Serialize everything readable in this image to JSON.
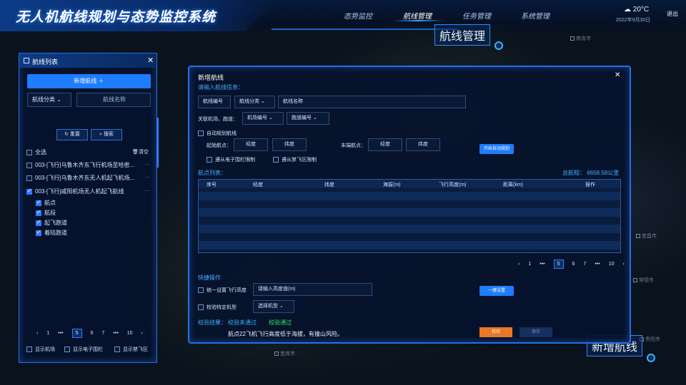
{
  "header": {
    "title": "无人机航线规划与态势监控系统",
    "nav": [
      "态势监控",
      "航线管理",
      "任务管理",
      "系统管理"
    ],
    "active_nav": "航线管理",
    "temperature": "20°C",
    "date": "2022年9月30日",
    "logout": "退出"
  },
  "map": {
    "cities": [
      "商洛市",
      "宜昌市",
      "常德市",
      "贵阳市",
      "宜宾市"
    ]
  },
  "float_labels": {
    "top": "航线管理",
    "bottom": "新增航线"
  },
  "sidebar": {
    "title": "航线列表",
    "add_button": "新增航线 ＋",
    "filter_category": "航线分类",
    "filter_name_placeholder": "航线名称",
    "reset_button": "重置",
    "search_button": "搜索",
    "select_all": "全选",
    "clear": "清空",
    "routes": [
      {
        "label": "003-[飞行]乌鲁木齐东飞行机场至哈密...",
        "checked": false
      },
      {
        "label": "003-[飞行]乌鲁木齐东无人机起飞机场...",
        "checked": false
      },
      {
        "label": "003-[飞行]咸阳机场无人机起飞航线",
        "checked": true
      }
    ],
    "sub_items": [
      "航点",
      "航段",
      "起飞跑道",
      "着陆跑道"
    ],
    "pagination": [
      "1",
      "•••",
      "5",
      "6",
      "7",
      "•••",
      "10"
    ],
    "show_airport": "显示机场",
    "show_fence": "显示电子围栏",
    "show_nofly": "显示禁飞区"
  },
  "dialog": {
    "title": "新增航线",
    "section_info": "请输入航线信息：",
    "route_no_placeholder": "航线编号",
    "route_category": "航线分类",
    "route_name_placeholder": "航线名称",
    "link_label": "关联机场、跑道：",
    "airport_select": "机场编号",
    "runway_select": "跑道编号",
    "auto_plan": "自动规划航线",
    "start_label": "起始航点：",
    "end_label": "末端航点：",
    "lng_placeholder": "经度",
    "lat_placeholder": "纬度",
    "start_auto_button": "开始自动规划",
    "follow_fence": "遵从电子围栏限制",
    "follow_nofly": "遵从禁飞区限制",
    "waypoints_label": "航点列表：",
    "total_range": "总航程： 6658.58公里",
    "columns": [
      "序号",
      "经度",
      "纬度",
      "海拔(m)",
      "飞行高度(m)",
      "距离(km)",
      "操作"
    ],
    "pagination": [
      "1",
      "•••",
      "5",
      "6",
      "7",
      "•••",
      "10"
    ],
    "quick_ops": "快捷操作",
    "unify_height": "统一设置飞行高度",
    "height_placeholder": "请输入高度值(m)",
    "one_click": "一键设置",
    "check_model": "校验特定机型",
    "model_select": "选择机型",
    "result_label": "校验结果：",
    "result_fail": "校验未通过",
    "result_pass": "校验通过",
    "check_button": "校验",
    "save_button": "保存",
    "message": "航点22飞机飞行高度低于海拔，有撞山风险。"
  },
  "colors": {
    "accent": "#1e7dff",
    "fail": "#32b4ff",
    "pass": "#2ee86a",
    "check_button": "#e8772a"
  }
}
